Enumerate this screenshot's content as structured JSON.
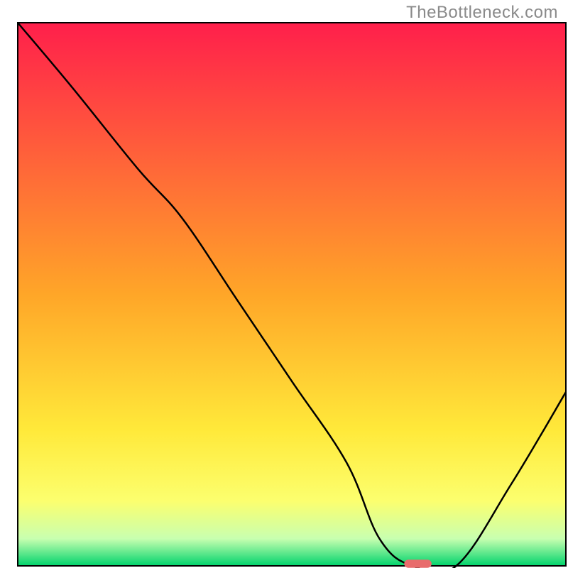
{
  "watermark": {
    "text": "TheBottleneck.com"
  },
  "chart_data": {
    "type": "line",
    "title": "",
    "xlabel": "",
    "ylabel": "",
    "xlim": [
      0,
      100
    ],
    "ylim": [
      0,
      100
    ],
    "grid": false,
    "legend": false,
    "background_gradient": {
      "stops": [
        {
          "offset": 0,
          "color": "#ff1f4b"
        },
        {
          "offset": 0.5,
          "color": "#ffa628"
        },
        {
          "offset": 0.75,
          "color": "#ffe93a"
        },
        {
          "offset": 0.88,
          "color": "#fcff6e"
        },
        {
          "offset": 0.95,
          "color": "#c8ffb0"
        },
        {
          "offset": 1.0,
          "color": "#00d36c"
        }
      ]
    },
    "series": [
      {
        "name": "bottleneck-curve",
        "color": "#000000",
        "x": [
          0,
          10,
          22,
          30,
          40,
          50,
          60,
          66,
          72,
          80,
          90,
          100
        ],
        "y": [
          100,
          88,
          73,
          64,
          49,
          34,
          19,
          5,
          0,
          0,
          15,
          32
        ]
      }
    ],
    "marker": {
      "name": "optimal-point",
      "x": 73,
      "y": 0,
      "color": "#e86c6c",
      "width": 5,
      "height": 1.5
    }
  }
}
